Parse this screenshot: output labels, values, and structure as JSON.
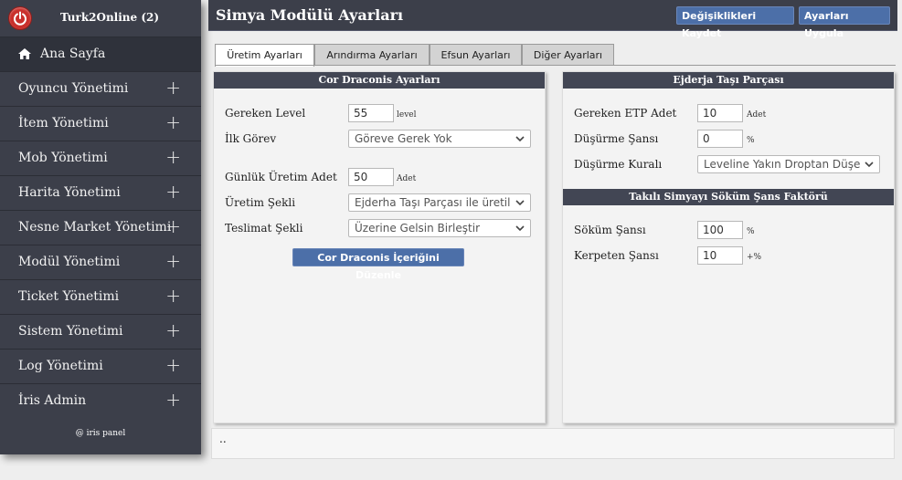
{
  "sidebar": {
    "title": "Turk2Online (2)",
    "footer": "@ iris panel",
    "items": [
      {
        "label": "Ana Sayfa"
      },
      {
        "label": "Oyuncu Yönetimi"
      },
      {
        "label": "İtem Yönetimi"
      },
      {
        "label": "Mob Yönetimi"
      },
      {
        "label": "Harita Yönetimi"
      },
      {
        "label": "Nesne Market Yönetimi"
      },
      {
        "label": "Modül Yönetimi"
      },
      {
        "label": "Ticket Yönetimi"
      },
      {
        "label": "Sistem Yönetimi"
      },
      {
        "label": "Log Yönetimi"
      },
      {
        "label": "İris Admin"
      }
    ]
  },
  "header": {
    "title": "Simya Modülü Ayarları",
    "save_label": "Değişiklikleri Kaydet",
    "apply_label": "Ayarları Uygula"
  },
  "tabs": [
    {
      "label": "Üretim Ayarları",
      "active": true
    },
    {
      "label": "Arındırma Ayarları"
    },
    {
      "label": "Efsun Ayarları"
    },
    {
      "label": "Diğer Ayarları"
    }
  ],
  "left_panel": {
    "title": "Cor Draconis Ayarları",
    "required_level_label": "Gereken Level",
    "required_level_value": "55",
    "required_level_unit": "level",
    "first_task_label": "İlk Görev",
    "first_task_value": "Göreve Gerek Yok",
    "daily_count_label": "Günlük Üretim Adet",
    "daily_count_value": "50",
    "daily_count_unit": "Adet",
    "production_type_label": "Üretim Şekli",
    "production_type_value": "Ejderha Taşı Parçası ile üretil",
    "delivery_type_label": "Teslimat Şekli",
    "delivery_type_value": "Üzerine Gelsin Birleştir",
    "edit_button": "Cor Draconis İçeriğini Düzenle"
  },
  "right_panel": {
    "title": "Ejderja Taşı Parçası",
    "required_etp_label": "Gereken ETP Adet",
    "required_etp_value": "10",
    "required_etp_unit": "Adet",
    "drop_chance_label": "Düşürme Şansı",
    "drop_chance_value": "0",
    "drop_chance_unit": "%",
    "drop_rule_label": "Düşürme Kuralı",
    "drop_rule_value": "Leveline Yakın Droptan Düşe",
    "section2_title": "Takılı Simyayı Söküm Şans Faktörü",
    "removal_label": "Söküm Şansı",
    "removal_value": "100",
    "removal_unit": "%",
    "pliers_label": "Kerpeten Şansı",
    "pliers_value": "10",
    "pliers_unit": "+%"
  },
  "footer_bar": {
    "text": ".."
  },
  "colors": {
    "sidebar": "#3c3f4a",
    "accent_button": "#4c6fa8",
    "panel_header": "#424654"
  }
}
